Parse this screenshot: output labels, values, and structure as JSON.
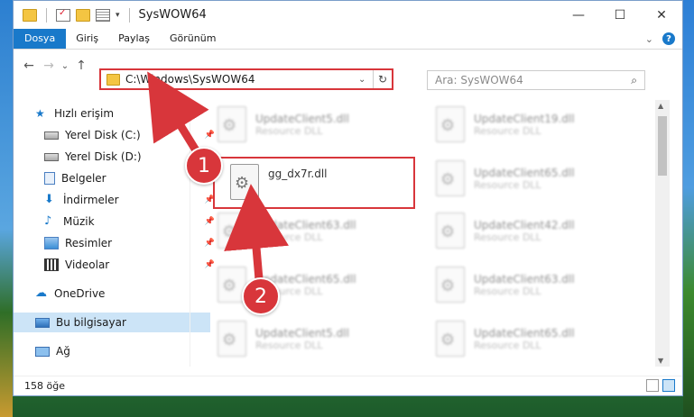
{
  "window": {
    "title": "SysWOW64"
  },
  "window_controls": {
    "minimize": "—",
    "maximize": "☐",
    "close": "✕"
  },
  "ribbon": {
    "tabs": [
      "Dosya",
      "Giriş",
      "Paylaş",
      "Görünüm"
    ],
    "active_tab": "Dosya",
    "help": "?",
    "expand": "⌄"
  },
  "nav": {
    "back": "←",
    "forward": "→",
    "recent": "⌄",
    "up": "↑"
  },
  "address": {
    "path": "C:\\Windows\\SysWOW64",
    "dropdown": "⌄",
    "refresh": "↻"
  },
  "search": {
    "placeholder": "Ara: SysWOW64",
    "icon": "⌕"
  },
  "sidebar": {
    "items": [
      {
        "label": "Hızlı erişim",
        "icon": "star-icon",
        "pinned": false
      },
      {
        "label": "Yerel Disk (C:)",
        "icon": "drive-icon",
        "pinned": true
      },
      {
        "label": "Yerel Disk (D:)",
        "icon": "drive-icon",
        "pinned": true
      },
      {
        "label": "Belgeler",
        "icon": "documents-icon",
        "pinned": true
      },
      {
        "label": "İndirmeler",
        "icon": "download-icon",
        "pinned": true
      },
      {
        "label": "Müzik",
        "icon": "music-icon",
        "pinned": true
      },
      {
        "label": "Resimler",
        "icon": "pictures-icon",
        "pinned": true
      },
      {
        "label": "Videolar",
        "icon": "video-icon",
        "pinned": true
      },
      {
        "label": "OneDrive",
        "icon": "cloud-icon",
        "pinned": false
      },
      {
        "label": "Bu bilgisayar",
        "icon": "computer-icon",
        "pinned": false,
        "selected": true
      },
      {
        "label": "Ağ",
        "icon": "network-icon",
        "pinned": false
      }
    ],
    "pin_glyph": "📌"
  },
  "files": [
    {
      "name": "UpdateClient5.dll",
      "desc": "Resource DLL"
    },
    {
      "name": "UpdateClient19.dll",
      "desc": "Resource DLL"
    },
    {
      "name": "gg_dx7r.dll",
      "desc": ""
    },
    {
      "name": "UpdateClient65.dll",
      "desc": "Resource DLL"
    },
    {
      "name": "UpdateClient63.dll",
      "desc": "Resource DLL"
    },
    {
      "name": "UpdateClient42.dll",
      "desc": "Resource DLL"
    },
    {
      "name": "UpdateClient65.dll",
      "desc": "Resource DLL"
    },
    {
      "name": "UpdateClient63.dll",
      "desc": "Resource DLL"
    },
    {
      "name": "UpdateClient5.dll",
      "desc": "Resource DLL"
    },
    {
      "name": "UpdateClient65.dll",
      "desc": "Resource DLL"
    }
  ],
  "status": {
    "count": "158 öğe"
  },
  "annotations": {
    "step1": "1",
    "step2": "2",
    "color": "#d8363b"
  }
}
